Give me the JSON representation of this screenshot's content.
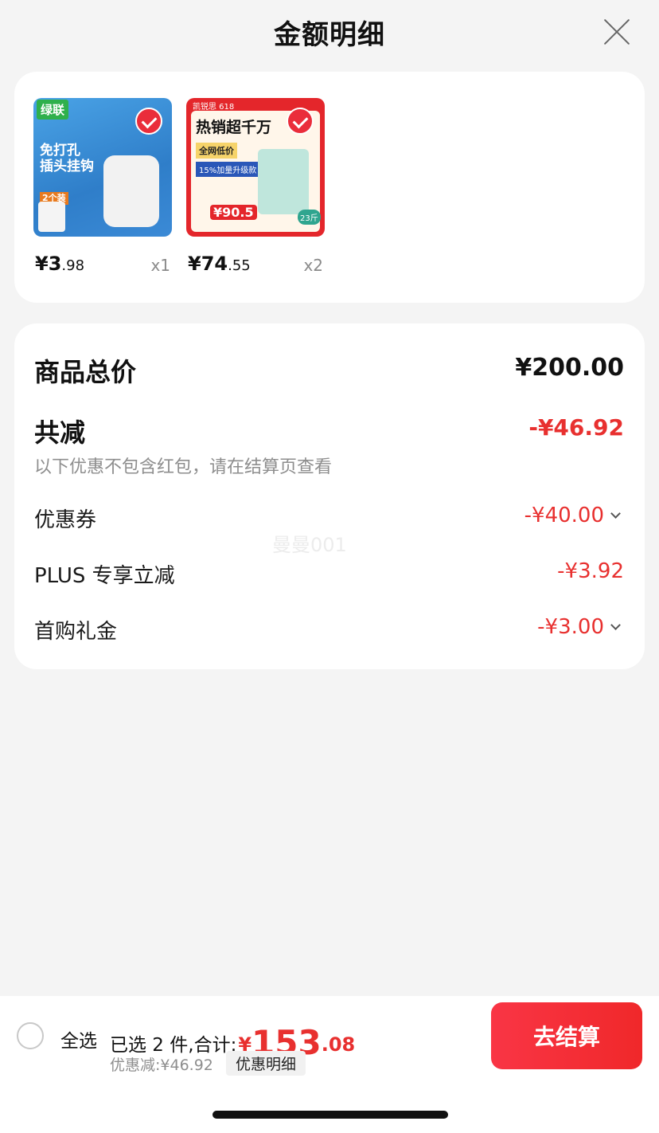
{
  "header": {
    "title": "金额明细"
  },
  "products": [
    {
      "thumb_brand": "绿联",
      "thumb_headline": "免打孔\n插头挂钩",
      "thumb_sub": "2个装",
      "price_main": "¥3",
      "price_dec": ".98",
      "qty": "x1"
    },
    {
      "thumb_brand": "凯锐思 618",
      "thumb_headline": "热销超千万",
      "thumb_tag1": "全网低价",
      "thumb_tag2": "15%加量升级款",
      "thumb_price": "¥90.5",
      "thumb_weight": "23斤",
      "price_main": "¥74",
      "price_dec": ".55",
      "qty": "x2"
    }
  ],
  "summary": {
    "total_label": "商品总价",
    "total_value": "¥200.00",
    "reduce_label": "共减",
    "reduce_value": "-¥46.92",
    "note": "以下优惠不包含红包，请在结算页查看",
    "items": [
      {
        "label": "优惠券",
        "value": "-¥40.00"
      },
      {
        "label": "PLUS 专享立减",
        "value": "-¥3.92"
      },
      {
        "label": "首购礼金",
        "value": "-¥3.00"
      }
    ],
    "watermark": "曼曼001"
  },
  "footer": {
    "select_all": "全选",
    "selected_prefix": "已选 2 件,合计:",
    "total_symbol": "¥",
    "total_int": "153",
    "total_dec": ".08",
    "discount_text": "优惠减:¥46.92",
    "detail_button": "优惠明细",
    "checkout_button": "去结算"
  },
  "colors": {
    "accent_red": "#e8302f",
    "check_red": "#ea2d3b",
    "background": "#f4f4f4"
  },
  "icons": [
    "close-icon",
    "checkmark-icon",
    "chevron-down-icon",
    "radio-unchecked-icon"
  ]
}
